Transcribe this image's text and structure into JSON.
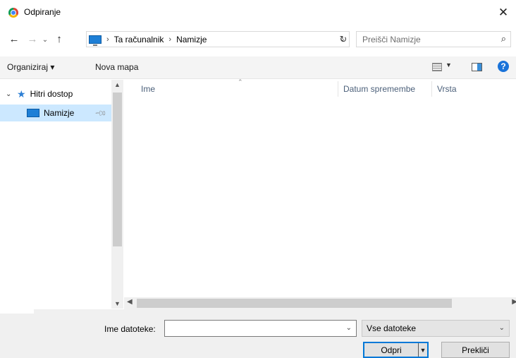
{
  "window": {
    "title": "Odpiranje"
  },
  "address": {
    "crumbs": [
      "Ta računalnik",
      "Namizje"
    ]
  },
  "search": {
    "placeholder": "Preišči Namizje"
  },
  "toolbar": {
    "organize_label": "Organiziraj ▾",
    "new_folder_label": "Nova mapa"
  },
  "nav_tree": {
    "quick_access": "Hitri dostop",
    "desktop": "Namizje"
  },
  "file_list": {
    "columns": [
      "Ime",
      "Datum spremembe",
      "Vrsta"
    ]
  },
  "footer": {
    "filename_label": "Ime datoteke:",
    "filename_value": "",
    "filetype_selected": "Vse datoteke",
    "open_label": "Odpri",
    "cancel_label": "Prekliči"
  },
  "colors": {
    "accent": "#0078d7",
    "selection": "#cce8ff",
    "folder_icon": "#1e7fd6"
  }
}
